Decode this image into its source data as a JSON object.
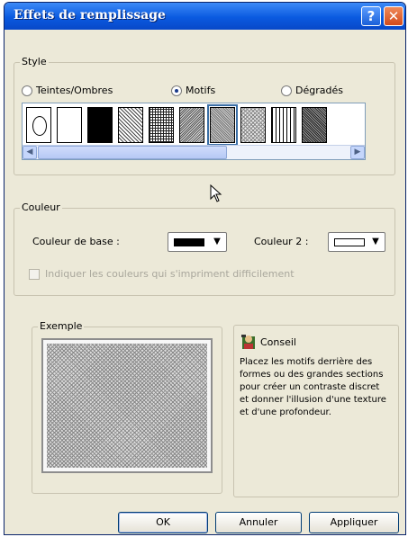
{
  "window": {
    "title": "Effets de remplissage",
    "help_glyph": "?",
    "close_glyph": "✕"
  },
  "style_group": {
    "legend": "Style",
    "radios": [
      {
        "label": "Teintes/Ombres",
        "checked": false
      },
      {
        "label": "Motifs",
        "checked": true
      },
      {
        "label": "Dégradés",
        "checked": false
      }
    ],
    "patterns": [
      "frame-oval",
      "white",
      "black",
      "dots",
      "grid",
      "fine-diagonal",
      "selected-diagonal",
      "checker",
      "vertical-lines",
      "dense-diagonal"
    ],
    "selected_pattern_index": 6,
    "scroll_left": "◀",
    "scroll_right": "▶"
  },
  "color_group": {
    "legend": "Couleur",
    "base_label": "Couleur de base :",
    "base_color": "#000000",
    "color2_label": "Couleur 2 :",
    "color2": "#ffffff",
    "dropdown_glyph": "▼",
    "print_check_label": "Indiquer les couleurs qui s'impriment difficilement",
    "print_check_checked": false,
    "print_check_enabled": false
  },
  "example_group": {
    "legend": "Exemple"
  },
  "tip": {
    "title": "Conseil",
    "text": "Placez les motifs derrière des formes ou des grandes sections pour créer un contraste discret et donner l'illusion d'une texture et d'une profondeur."
  },
  "buttons": {
    "ok": "OK",
    "cancel": "Annuler",
    "apply": "Appliquer"
  }
}
